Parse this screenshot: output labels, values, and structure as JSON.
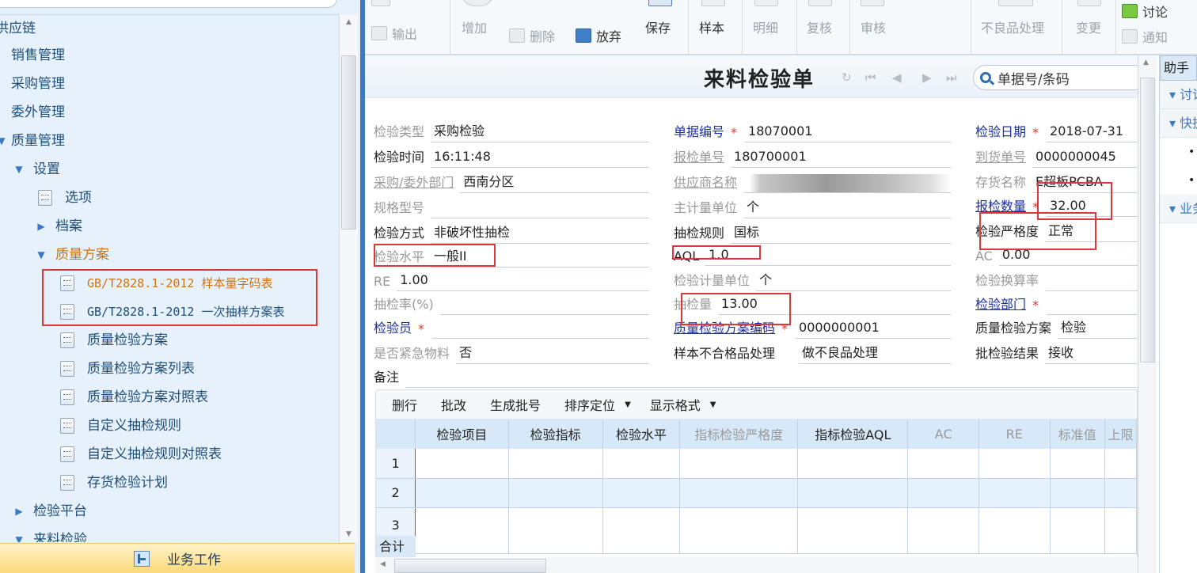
{
  "sidebar": {
    "tree": [
      {
        "label": "供应链",
        "state": "partial"
      },
      {
        "label": "销售管理"
      },
      {
        "label": "采购管理"
      },
      {
        "label": "委外管理"
      },
      {
        "label": "质量管理",
        "state": "expanded"
      },
      {
        "label": "设置",
        "state": "expanded"
      },
      {
        "label": "选项"
      },
      {
        "label": "档案",
        "state": "collapsed"
      },
      {
        "label": "质量方案",
        "state": "expanded"
      },
      {
        "label": "GB/T2828.1-2012 样本量字码表",
        "highlighted": true
      },
      {
        "label": "GB/T2828.1-2012 一次抽样方案表",
        "highlighted": true
      },
      {
        "label": "质量检验方案"
      },
      {
        "label": "质量检验方案列表"
      },
      {
        "label": "质量检验方案对照表"
      },
      {
        "label": "自定义抽检规则"
      },
      {
        "label": "自定义抽检规则对照表"
      },
      {
        "label": "存货检验计划"
      },
      {
        "label": "检验平台",
        "state": "collapsed"
      },
      {
        "label": "来料检验",
        "state": "expanded"
      }
    ],
    "footer_label": "业务工作"
  },
  "toolbar": {
    "export": "输出",
    "add": "增加",
    "delete": "删除",
    "discard": "放弃",
    "save": "保存",
    "sample": "样本",
    "detail": "明细",
    "recheck": "复核",
    "audit": "审核",
    "defect": "不良品处理",
    "change": "变更",
    "discuss": "讨论",
    "notify": "通知"
  },
  "form": {
    "title": "来料检验单",
    "search_placeholder": "单据号/条码",
    "fields": {
      "insp_type": {
        "label": "检验类型",
        "value": "采购检验"
      },
      "insp_time": {
        "label": "检验时间",
        "value": "16:11:48"
      },
      "dept": {
        "label": "采购/委外部门",
        "value": "西南分区"
      },
      "spec": {
        "label": "规格型号",
        "value": ""
      },
      "insp_method": {
        "label": "检验方式",
        "value": "非破坏性抽检"
      },
      "insp_level": {
        "label": "检验水平",
        "value": "一般II"
      },
      "re": {
        "label": "RE",
        "value": "1.00"
      },
      "sample_rate": {
        "label": "抽检率(%)",
        "value": ""
      },
      "inspector": {
        "label": "检验员",
        "value": ""
      },
      "urgent": {
        "label": "是否紧急物料",
        "value": "否"
      },
      "remark": {
        "label": "备注",
        "value": ""
      },
      "doc_no": {
        "label": "单据编号",
        "value": "18070001"
      },
      "report_no": {
        "label": "报检单号",
        "value": "180700001"
      },
      "supplier": {
        "label": "供应商名称",
        "value": "（已模糊处理）"
      },
      "main_unit": {
        "label": "主计量单位",
        "value": "个"
      },
      "sample_rule": {
        "label": "抽检规则",
        "value": "国标"
      },
      "aql": {
        "label": "AQL",
        "value": "1.0"
      },
      "insp_unit": {
        "label": "检验计量单位",
        "value": "个"
      },
      "sample_qty": {
        "label": "抽检量",
        "value": "13.00"
      },
      "plan_code": {
        "label": "质量检验方案编码",
        "value": "0000000001"
      },
      "sample_ng": {
        "label": "样本不合格品处理",
        "value": "做不良品处理"
      },
      "insp_date": {
        "label": "检验日期",
        "value": "2018-07-31"
      },
      "arrival_no": {
        "label": "到货单号",
        "value": "0000000045"
      },
      "inventory": {
        "label": "存货名称",
        "value": "E超板PCBA"
      },
      "report_qty": {
        "label": "报检数量",
        "value": "32.00"
      },
      "severity": {
        "label": "检验严格度",
        "value": "正常"
      },
      "ac": {
        "label": "AC",
        "value": "0.00"
      },
      "conv_rate": {
        "label": "检验换算率",
        "value": ""
      },
      "insp_dept": {
        "label": "检验部门",
        "value": ""
      },
      "quality_plan": {
        "label": "质量检验方案",
        "value": "检验"
      },
      "batch_result": {
        "label": "批检验结果",
        "value": "接收"
      }
    }
  },
  "grid": {
    "toolbar": [
      "删行",
      "批改",
      "生成批号",
      "排序定位",
      "显示格式"
    ],
    "columns": [
      "检验项目",
      "检验指标",
      "检验水平",
      "指标检验严格度",
      "指标检验AQL",
      "AC",
      "RE",
      "标准值",
      "上限"
    ],
    "rows": [
      "1",
      "2",
      "3"
    ],
    "sum_label": "合计"
  },
  "helper": {
    "title": "助手",
    "sections": [
      "讨论",
      "快捷",
      "业务"
    ]
  }
}
